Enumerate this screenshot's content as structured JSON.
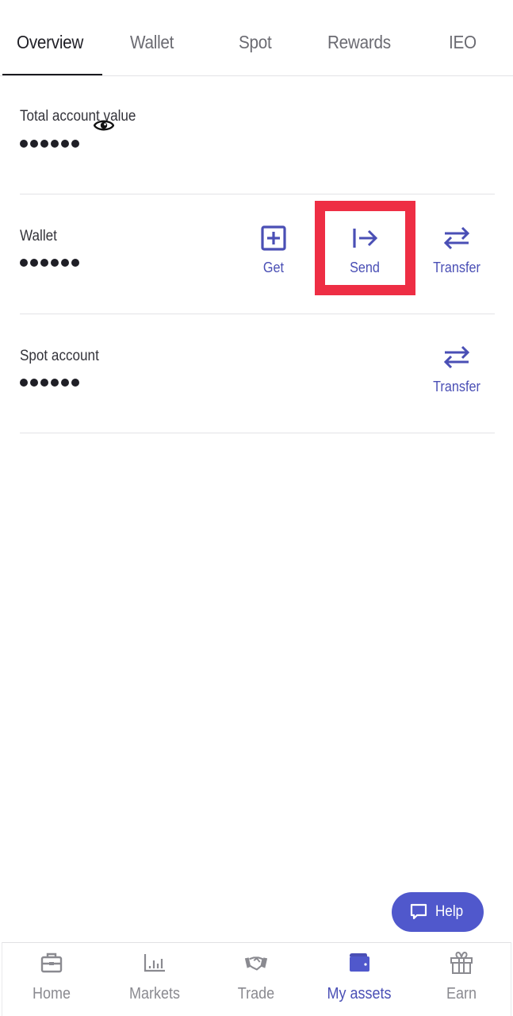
{
  "tabs": [
    {
      "label": "Overview",
      "active": true
    },
    {
      "label": "Wallet",
      "active": false
    },
    {
      "label": "Spot",
      "active": false
    },
    {
      "label": "Rewards",
      "active": false
    },
    {
      "label": "IEO",
      "active": false
    }
  ],
  "overview": {
    "total_label": "Total account value",
    "total_value_masked": "••••••",
    "visibility_icon": "eye-icon"
  },
  "wallet": {
    "label": "Wallet",
    "value_masked": "••••••",
    "actions": [
      {
        "label": "Get",
        "icon": "plus-square-icon"
      },
      {
        "label": "Send",
        "icon": "send-arrow-icon",
        "highlighted": true
      },
      {
        "label": "Transfer",
        "icon": "transfer-arrows-icon"
      }
    ]
  },
  "spot": {
    "label": "Spot account",
    "value_masked": "••••••",
    "actions": [
      {
        "label": "Transfer",
        "icon": "transfer-arrows-icon"
      }
    ]
  },
  "help": {
    "label": "Help",
    "icon": "chat-bubble-icon"
  },
  "bottom_nav": [
    {
      "label": "Home",
      "icon": "briefcase-icon",
      "active": false
    },
    {
      "label": "Markets",
      "icon": "bar-chart-icon",
      "active": false
    },
    {
      "label": "Trade",
      "icon": "handshake-icon",
      "active": false
    },
    {
      "label": "My assets",
      "icon": "wallet-icon",
      "active": true
    },
    {
      "label": "Earn",
      "icon": "gift-icon",
      "active": false
    }
  ],
  "colors": {
    "accent": "#5058cc",
    "accent_text": "#4a4fb5",
    "highlight_box": "#ee2e44",
    "inactive": "#8a8a90"
  }
}
